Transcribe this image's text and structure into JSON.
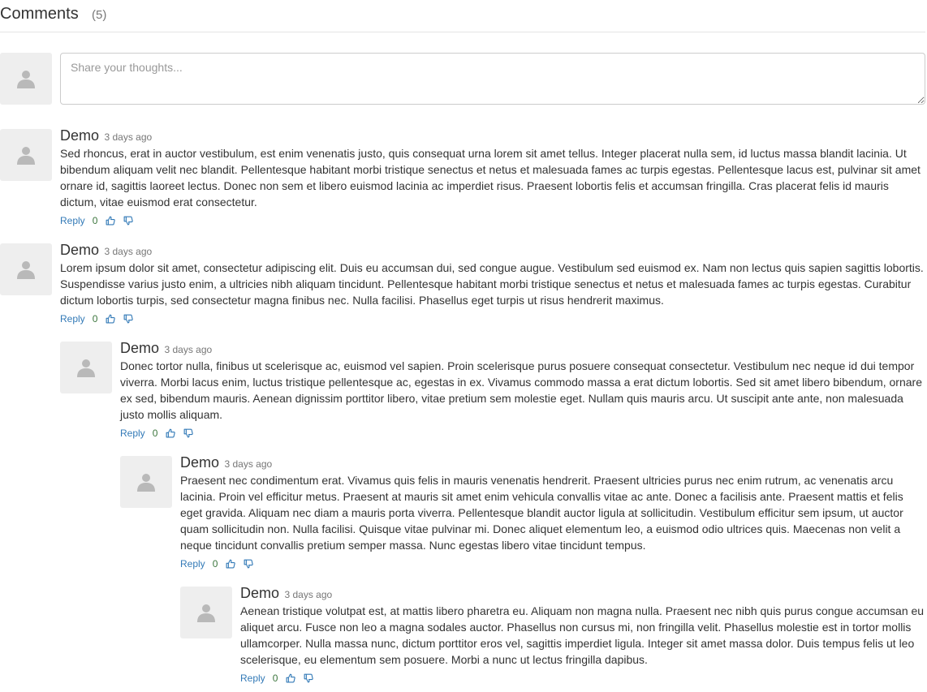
{
  "header": {
    "title": "Comments",
    "count": "(5)"
  },
  "composer": {
    "placeholder": "Share your thoughts..."
  },
  "colors": {
    "link": "#337ab7",
    "score": "#3c763d",
    "avatar_bg": "#eeeeee",
    "avatar_icon": "#b9b9b9"
  },
  "comments": [
    {
      "author": "Demo",
      "time": "3 days ago",
      "text": "Sed rhoncus, erat in auctor vestibulum, est enim venenatis justo, quis consequat urna lorem sit amet tellus. Integer placerat nulla sem, id luctus massa blandit lacinia. Ut bibendum aliquam velit nec blandit. Pellentesque habitant morbi tristique senectus et netus et malesuada fames ac turpis egestas. Pellentesque lacus est, pulvinar sit amet ornare id, sagittis laoreet lectus. Donec non sem et libero euismod lacinia ac imperdiet risus. Praesent lobortis felis et accumsan fringilla. Cras placerat felis id mauris dictum, vitae euismod erat consectetur.",
      "reply_label": "Reply",
      "score": "0",
      "upvote_icon": "thumbs-up-icon",
      "downvote_icon": "thumbs-down-icon"
    },
    {
      "author": "Demo",
      "time": "3 days ago",
      "text": "Lorem ipsum dolor sit amet, consectetur adipiscing elit. Duis eu accumsan dui, sed congue augue. Vestibulum sed euismod ex. Nam non lectus quis sapien sagittis lobortis. Suspendisse varius justo enim, a ultricies nibh aliquam tincidunt. Pellentesque habitant morbi tristique senectus et netus et malesuada fames ac turpis egestas. Curabitur dictum lobortis turpis, sed consectetur magna finibus nec. Nulla facilisi. Phasellus eget turpis ut risus hendrerit maximus.",
      "reply_label": "Reply",
      "score": "0",
      "upvote_icon": "thumbs-up-icon",
      "downvote_icon": "thumbs-down-icon"
    },
    {
      "author": "Demo",
      "time": "3 days ago",
      "text": "Donec tortor nulla, finibus ut scelerisque ac, euismod vel sapien. Proin scelerisque purus posuere consequat consectetur. Vestibulum nec neque id dui tempor viverra. Morbi lacus enim, luctus tristique pellentesque ac, egestas in ex. Vivamus commodo massa a erat dictum lobortis. Sed sit amet libero bibendum, ornare ex sed, bibendum mauris. Aenean dignissim porttitor libero, vitae pretium sem molestie eget. Nullam quis mauris arcu. Ut suscipit ante ante, non malesuada justo mollis aliquam.",
      "reply_label": "Reply",
      "score": "0",
      "upvote_icon": "thumbs-up-icon",
      "downvote_icon": "thumbs-down-icon"
    },
    {
      "author": "Demo",
      "time": "3 days ago",
      "text": "Praesent nec condimentum erat. Vivamus quis felis in mauris venenatis hendrerit. Praesent ultricies purus nec enim rutrum, ac venenatis arcu lacinia. Proin vel efficitur metus. Praesent at mauris sit amet enim vehicula convallis vitae ac ante. Donec a facilisis ante. Praesent mattis et felis eget gravida. Aliquam nec diam a mauris porta viverra. Pellentesque blandit auctor ligula at sollicitudin. Vestibulum efficitur sem ipsum, ut auctor quam sollicitudin non. Nulla facilisi. Quisque vitae pulvinar mi. Donec aliquet elementum leo, a euismod odio ultrices quis. Maecenas non velit a neque tincidunt convallis pretium semper massa. Nunc egestas libero vitae tincidunt tempus.",
      "reply_label": "Reply",
      "score": "0",
      "upvote_icon": "thumbs-up-icon",
      "downvote_icon": "thumbs-down-icon"
    },
    {
      "author": "Demo",
      "time": "3 days ago",
      "text": "Aenean tristique volutpat est, at mattis libero pharetra eu. Aliquam non magna nulla. Praesent nec nibh quis purus congue accumsan eu aliquet arcu. Fusce non leo a magna sodales auctor. Phasellus non cursus mi, non fringilla velit. Phasellus molestie est in tortor mollis ullamcorper. Nulla massa nunc, dictum porttitor eros vel, sagittis imperdiet ligula. Integer sit amet massa dolor. Duis tempus felis ut leo scelerisque, eu elementum sem posuere. Morbi a nunc ut lectus fringilla dapibus.",
      "reply_label": "Reply",
      "score": "0",
      "upvote_icon": "thumbs-up-icon",
      "downvote_icon": "thumbs-down-icon"
    }
  ]
}
